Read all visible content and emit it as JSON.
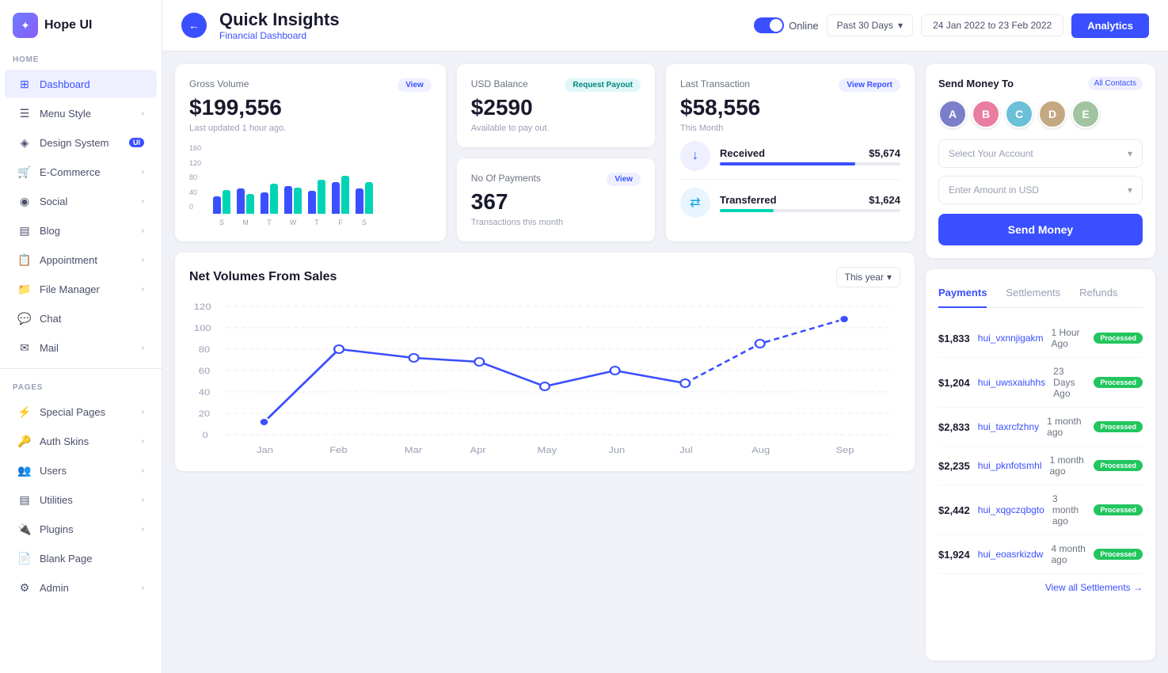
{
  "app": {
    "name": "Hope UI",
    "logo_letter": "✦"
  },
  "sidebar": {
    "home_label": "HOME",
    "pages_label": "PAGES",
    "items": [
      {
        "id": "dashboard",
        "label": "Dashboard",
        "icon": "⊞",
        "active": true,
        "badge": null,
        "chevron": false
      },
      {
        "id": "menu-style",
        "label": "Menu Style",
        "icon": "☰",
        "active": false,
        "badge": null,
        "chevron": true
      },
      {
        "id": "design-system",
        "label": "Design System",
        "icon": "◈",
        "active": false,
        "badge": "UI",
        "chevron": false
      },
      {
        "id": "e-commerce",
        "label": "E-Commerce",
        "icon": "🛒",
        "active": false,
        "badge": null,
        "chevron": true
      },
      {
        "id": "social",
        "label": "Social",
        "icon": "◉",
        "active": false,
        "badge": null,
        "chevron": true
      },
      {
        "id": "blog",
        "label": "Blog",
        "icon": "▤",
        "active": false,
        "badge": null,
        "chevron": true
      },
      {
        "id": "appointment",
        "label": "Appointment",
        "icon": "📋",
        "active": false,
        "badge": null,
        "chevron": true
      },
      {
        "id": "file-manager",
        "label": "File Manager",
        "icon": "📁",
        "active": false,
        "badge": null,
        "chevron": true
      },
      {
        "id": "chat",
        "label": "Chat",
        "icon": "💬",
        "active": false,
        "badge": null,
        "chevron": false
      },
      {
        "id": "mail",
        "label": "Mail",
        "icon": "✉",
        "active": false,
        "badge": null,
        "chevron": true
      }
    ],
    "pages_items": [
      {
        "id": "special-pages",
        "label": "Special Pages",
        "icon": "⚡",
        "chevron": true
      },
      {
        "id": "auth-skins",
        "label": "Auth Skins",
        "icon": "🔑",
        "chevron": true
      },
      {
        "id": "users",
        "label": "Users",
        "icon": "👥",
        "chevron": true
      },
      {
        "id": "utilities",
        "label": "Utilities",
        "icon": "▤",
        "chevron": true
      },
      {
        "id": "plugins",
        "label": "Plugins",
        "icon": "🔌",
        "chevron": true
      },
      {
        "id": "blank-page",
        "label": "Blank Page",
        "icon": "📄",
        "chevron": false
      },
      {
        "id": "admin",
        "label": "Admin",
        "icon": "⚙",
        "chevron": true
      }
    ]
  },
  "header": {
    "title": "Quick Insights",
    "subtitle": "Financial Dashboard",
    "back_icon": "←",
    "online_label": "Online",
    "date_range_label": "Past 30 Days",
    "date_display": "24 Jan 2022 to 23 Feb 2022",
    "analytics_label": "Analytics"
  },
  "gross_volume": {
    "label": "Gross Volume",
    "value": "$199,556",
    "meta": "Last updated 1 hour ago.",
    "btn_label": "View",
    "bars": [
      {
        "blue": 40,
        "teal": 55
      },
      {
        "blue": 60,
        "teal": 45
      },
      {
        "blue": 50,
        "teal": 70
      },
      {
        "blue": 65,
        "teal": 60
      },
      {
        "blue": 55,
        "teal": 80
      },
      {
        "blue": 75,
        "teal": 90
      },
      {
        "blue": 60,
        "teal": 75
      }
    ],
    "chart_labels": [
      "S",
      "M",
      "T",
      "W",
      "T",
      "F",
      "S"
    ]
  },
  "usd_balance": {
    "label": "USD Balance",
    "value": "$2590",
    "meta": "Available to pay out.",
    "btn_label": "Request Payout",
    "no_payments_label": "No Of Payments",
    "no_payments_value": "367",
    "no_payments_meta": "Transactions this month",
    "no_payments_btn": "View"
  },
  "last_transaction": {
    "label": "Last Transaction",
    "value": "$58,556",
    "meta": "This Month",
    "btn_label": "View Report",
    "received": {
      "label": "Received",
      "amount": "$5,674",
      "progress": 75
    },
    "transferred": {
      "label": "Transferred",
      "amount": "$1,624",
      "progress": 30
    }
  },
  "send_money": {
    "title": "Send Money To",
    "all_contacts_label": "All Contacts",
    "select_account_placeholder": "Select Your Account",
    "amount_placeholder": "Enter Amount in USD",
    "send_btn_label": "Send Money",
    "contacts": [
      {
        "color": "#7b7ec8",
        "letter": "A"
      },
      {
        "color": "#e87da0",
        "letter": "B"
      },
      {
        "color": "#6bbfd8",
        "letter": "C"
      },
      {
        "color": "#c4a882",
        "letter": "D"
      },
      {
        "color": "#a0c4a0",
        "letter": "E"
      }
    ]
  },
  "net_volumes": {
    "title": "Net Volumes From Sales",
    "year_label": "This year",
    "y_labels": [
      "120",
      "100",
      "80",
      "60",
      "40",
      "20",
      "0"
    ],
    "x_labels": [
      "Jan",
      "Feb",
      "Mar",
      "Apr",
      "May",
      "Jun",
      "Jul",
      "Aug",
      "Sep"
    ],
    "data_points": [
      12,
      80,
      72,
      68,
      45,
      60,
      48,
      85,
      108
    ]
  },
  "payments": {
    "tabs": [
      "Payments",
      "Settlements",
      "Refunds"
    ],
    "active_tab": 0,
    "rows": [
      {
        "amount": "$1,833",
        "id": "hui_vxnnjigakm",
        "time": "1 Hour Ago",
        "status": "Processed"
      },
      {
        "amount": "$1,204",
        "id": "hui_uwsxaiuhhs",
        "time": "23 Days Ago",
        "status": "Processed"
      },
      {
        "amount": "$2,833",
        "id": "hui_taxrcfzhny",
        "time": "1 month ago",
        "status": "Processed"
      },
      {
        "amount": "$2,235",
        "id": "hui_pknfotsmhl",
        "time": "1 month ago",
        "status": "Processed"
      },
      {
        "amount": "$2,442",
        "id": "hui_xqgczqbgto",
        "time": "3 month ago",
        "status": "Processed"
      },
      {
        "amount": "$1,924",
        "id": "hui_eoasrkizdw",
        "time": "4 month ago",
        "status": "Processed"
      }
    ],
    "view_all_label": "View all Settlements →"
  }
}
